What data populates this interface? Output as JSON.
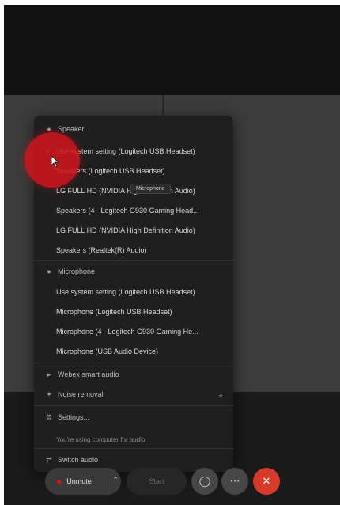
{
  "menu": {
    "speaker_section": "Speaker",
    "speakers": [
      "Use system setting (Logitech USB Headset)",
      "Speakers (Logitech USB Headset)",
      "LG FULL HD (NVIDIA High Definition Audio)",
      "Speakers (4 - Logitech G930 Gaming Head...",
      "LG FULL HD (NVIDIA High Definition Audio)",
      "Speakers (Realtek(R) Audio)"
    ],
    "microphone_section": "Microphone",
    "microphones": [
      "Use system setting (Logitech USB Headset)",
      "Microphone (Logitech USB Headset)",
      "Microphone (4 - Logitech G930 Gaming He...",
      "Microphone (USB Audio Device)"
    ],
    "webex_smart_audio": "Webex smart audio",
    "noise_removal": "Noise removal",
    "settings": "Settings...",
    "computer_audio_hint": "You're using computer for audio",
    "switch_audio": "Switch audio",
    "tooltip": "Microphone"
  },
  "controls": {
    "unmute_label": "Unmute",
    "camera_label": "Start"
  },
  "icons": {
    "speaker": "speaker-icon",
    "microphone": "microphone-icon",
    "check": "check-icon",
    "chevron": "chevron-right-icon",
    "noise": "sparkle-icon",
    "settings": "gear-icon",
    "switch": "switch-icon",
    "pointer": "mouse-pointer-icon"
  },
  "colors": {
    "leave_button": "#d63a2a",
    "cursor_highlight": "#ce161e"
  }
}
